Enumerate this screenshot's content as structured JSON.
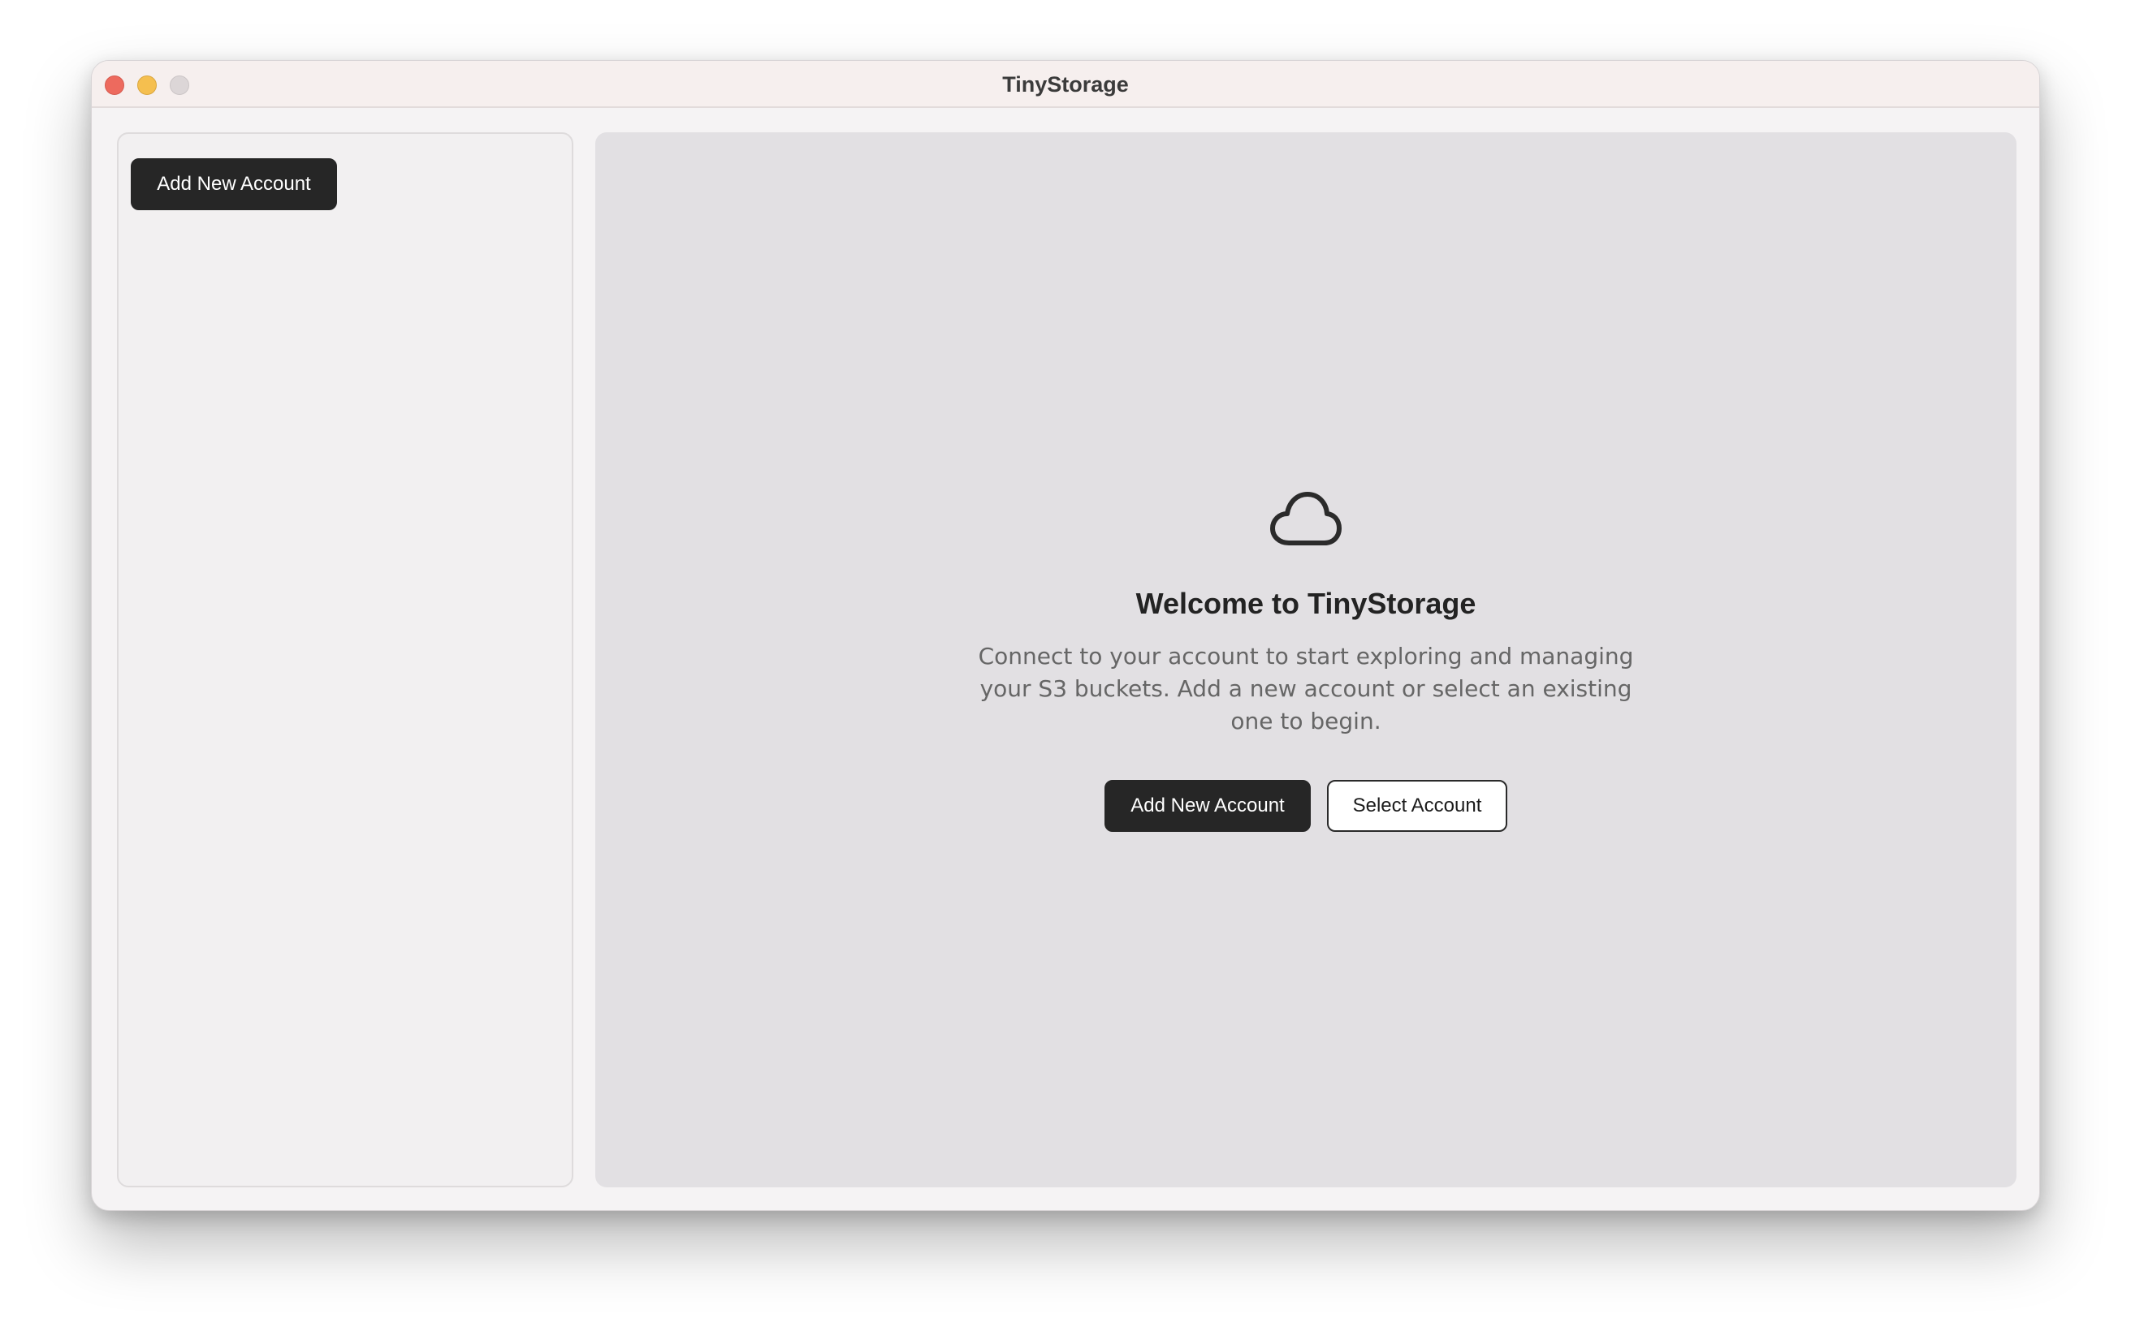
{
  "window": {
    "title": "TinyStorage"
  },
  "sidebar": {
    "add_account_label": "Add New Account"
  },
  "main": {
    "icon": "cloud-icon",
    "heading": "Welcome to TinyStorage",
    "description": "Connect to your account to start exploring and managing your S3 buckets. Add a new account or select an existing one to begin.",
    "primary_button_label": "Add New Account",
    "secondary_button_label": "Select Account"
  },
  "colors": {
    "primary_button": "#262626",
    "main_panel_bg": "#e2e0e3",
    "sidebar_bg": "#f2f0f1",
    "titlebar_bg": "#f6efee"
  }
}
